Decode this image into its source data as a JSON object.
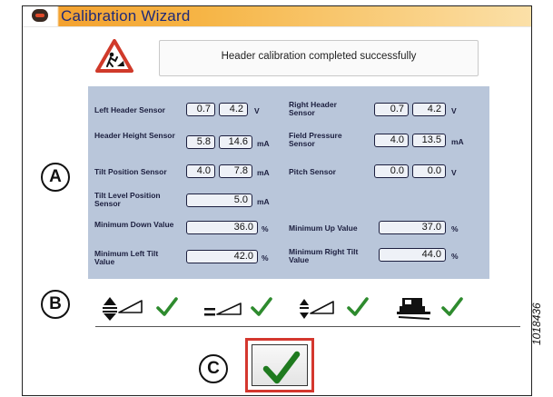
{
  "window": {
    "title": "Calibration Wizard",
    "icon": "app-logo-icon"
  },
  "status": {
    "icon": "warning-construction-icon",
    "message": "Header calibration completed successfully"
  },
  "readings": {
    "left_header_sensor": {
      "label": "Left Header Sensor",
      "value1": "0.7",
      "value2": "4.2",
      "unit": "V"
    },
    "right_header_sensor": {
      "label": "Right Header Sensor",
      "value1": "0.7",
      "value2": "4.2",
      "unit": "V"
    },
    "header_height_sensor": {
      "label": "Header Height Sensor",
      "value1": "5.8",
      "value2": "14.6",
      "unit": "mA"
    },
    "field_pressure_sensor": {
      "label": "Field Pressure Sensor",
      "value1": "4.0",
      "value2": "13.5",
      "unit": "mA"
    },
    "tilt_position_sensor": {
      "label": "Tilt Position Sensor",
      "value1": "4.0",
      "value2": "7.8",
      "unit": "mA"
    },
    "pitch_sensor": {
      "label": "Pitch Sensor",
      "value1": "0.0",
      "value2": "0.0",
      "unit": "V"
    },
    "tilt_level_position_sensor": {
      "label": "Tilt Level Position Sensor",
      "value": "5.0",
      "unit": "mA"
    },
    "minimum_down_value": {
      "label": "Minimum Down Value",
      "value": "36.0",
      "unit": "%"
    },
    "minimum_up_value": {
      "label": "Minimum Up Value",
      "value": "37.0",
      "unit": "%"
    },
    "minimum_left_tilt_value": {
      "label": "Minimum Left Tilt Value",
      "value": "42.0",
      "unit": "%"
    },
    "minimum_right_tilt_value": {
      "label": "Minimum Right Tilt Value",
      "value": "44.0",
      "unit": "%"
    }
  },
  "callouts": {
    "a": "A",
    "b": "B",
    "c": "C"
  },
  "step_icons": [
    "header-height-icon",
    "header-level-icon",
    "tilt-icon",
    "header-machine-icon"
  ],
  "confirm_icon": "checkmark-icon",
  "figure_id": "1018436",
  "colors": {
    "accent_orange": "#f3a230",
    "panel_blue": "#b9c6da",
    "check_green": "#2e8b2e",
    "confirm_border": "#d4372e"
  }
}
